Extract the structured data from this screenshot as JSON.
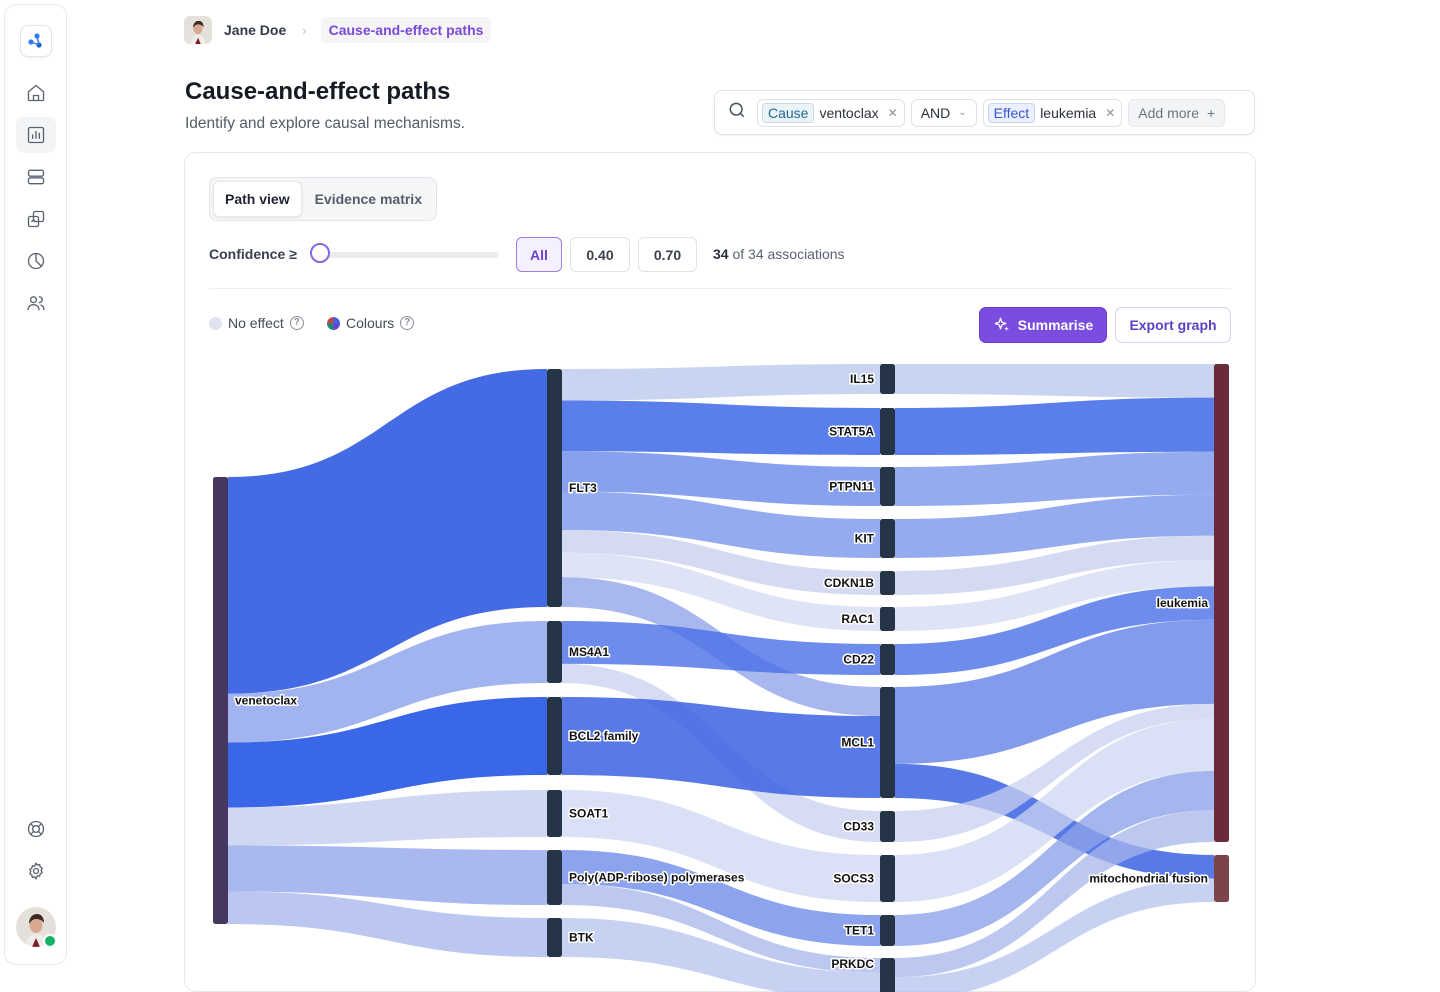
{
  "breadcrumb": {
    "user": "Jane Doe",
    "current": "Cause-and-effect paths"
  },
  "header": {
    "title": "Cause-and-effect paths",
    "subtitle": "Identify and explore causal mechanisms."
  },
  "search": {
    "cause_tag": "Cause",
    "cause_value": "ventoclax",
    "operator": "AND",
    "effect_tag": "Effect",
    "effect_value": "leukemia",
    "add_more": "Add more"
  },
  "tabs": {
    "path_view": "Path view",
    "evidence_matrix": "Evidence matrix"
  },
  "filter": {
    "confidence_label": "Confidence ≥",
    "confidence_value": 0,
    "thresholds": [
      "All",
      "0.40",
      "0.70"
    ],
    "count_shown": "34",
    "count_text": "of 34 associations"
  },
  "legend": {
    "no_effect": "No effect",
    "colours": "Colours"
  },
  "actions": {
    "summarise": "Summarise",
    "export": "Export graph"
  },
  "colors": {
    "accent": "#7a4ce0",
    "node": "#263447",
    "source_node": "#45375f",
    "target_leukemia": "#6b2a3a",
    "target_mito": "#7a4448"
  },
  "chart_data": {
    "type": "sankey",
    "nodes": [
      {
        "id": "venetoclax",
        "label": "venetoclax",
        "column": 0
      },
      {
        "id": "FLT3",
        "label": "FLT3",
        "column": 1
      },
      {
        "id": "MS4A1",
        "label": "MS4A1",
        "column": 1
      },
      {
        "id": "BCL2",
        "label": "BCL2 family",
        "column": 1
      },
      {
        "id": "SOAT1",
        "label": "SOAT1",
        "column": 1
      },
      {
        "id": "PARP",
        "label": "Poly(ADP-ribose) polymerases",
        "column": 1
      },
      {
        "id": "BTK",
        "label": "BTK",
        "column": 1
      },
      {
        "id": "IL15",
        "label": "IL15",
        "column": 2
      },
      {
        "id": "STAT5A",
        "label": "STAT5A",
        "column": 2
      },
      {
        "id": "PTPN11",
        "label": "PTPN11",
        "column": 2
      },
      {
        "id": "KIT",
        "label": "KIT",
        "column": 2
      },
      {
        "id": "CDKN1B",
        "label": "CDKN1B",
        "column": 2
      },
      {
        "id": "RAC1",
        "label": "RAC1",
        "column": 2
      },
      {
        "id": "CD22",
        "label": "CD22",
        "column": 2
      },
      {
        "id": "MCL1",
        "label": "MCL1",
        "column": 2
      },
      {
        "id": "CD33",
        "label": "CD33",
        "column": 2
      },
      {
        "id": "SOCS3",
        "label": "SOCS3",
        "column": 2
      },
      {
        "id": "TET1",
        "label": "TET1",
        "column": 2
      },
      {
        "id": "PRKDC",
        "label": "PRKDC",
        "column": 2
      },
      {
        "id": "leukemia",
        "label": "leukemia",
        "column": 3
      },
      {
        "id": "mito",
        "label": "mitochondrial fusion",
        "column": 3
      }
    ],
    "links": [
      {
        "source": "venetoclax",
        "target": "FLT3",
        "value": 160,
        "color": "#3b63e3",
        "opacity": 0.95
      },
      {
        "source": "venetoclax",
        "target": "MS4A1",
        "value": 36,
        "color": "#8ba1ec",
        "opacity": 0.8
      },
      {
        "source": "venetoclax",
        "target": "BCL2",
        "value": 48,
        "color": "#2f5fe6",
        "opacity": 0.95
      },
      {
        "source": "venetoclax",
        "target": "SOAT1",
        "value": 28,
        "color": "#c3cdf0",
        "opacity": 0.8
      },
      {
        "source": "venetoclax",
        "target": "PARP",
        "value": 34,
        "color": "#93a6ea",
        "opacity": 0.8
      },
      {
        "source": "venetoclax",
        "target": "BTK",
        "value": 24,
        "color": "#aab8ee",
        "opacity": 0.8
      },
      {
        "source": "FLT3",
        "target": "IL15",
        "value": 18,
        "color": "#b7c5ec",
        "opacity": 0.75
      },
      {
        "source": "FLT3",
        "target": "STAT5A",
        "value": 29,
        "color": "#3d67e6",
        "opacity": 0.85
      },
      {
        "source": "FLT3",
        "target": "PTPN11",
        "value": 23,
        "color": "#6a8aea",
        "opacity": 0.8
      },
      {
        "source": "FLT3",
        "target": "KIT",
        "value": 22,
        "color": "#7a96ec",
        "opacity": 0.8
      },
      {
        "source": "FLT3",
        "target": "CDKN1B",
        "value": 13,
        "color": "#c5cdee",
        "opacity": 0.75
      },
      {
        "source": "FLT3",
        "target": "RAC1",
        "value": 14,
        "color": "#d3d9f2",
        "opacity": 0.75
      },
      {
        "source": "FLT3",
        "target": "MCL1",
        "value": 17,
        "color": "#8b9fe8",
        "opacity": 0.75
      },
      {
        "source": "MS4A1",
        "target": "CD22",
        "value": 18,
        "color": "#4a6fe6",
        "opacity": 0.8
      },
      {
        "source": "MS4A1",
        "target": "CD33",
        "value": 8,
        "color": "#c8d0ef",
        "opacity": 0.75
      },
      {
        "source": "BCL2",
        "target": "MCL1",
        "value": 48,
        "color": "#3c62e2",
        "opacity": 0.85
      },
      {
        "source": "SOAT1",
        "target": "SOCS3",
        "value": 28,
        "color": "#cdd5f1",
        "opacity": 0.75
      },
      {
        "source": "PARP",
        "target": "TET1",
        "value": 21,
        "color": "#6f8cea",
        "opacity": 0.8
      },
      {
        "source": "PARP",
        "target": "PRKDC",
        "value": 13,
        "color": "#a7b6ec",
        "opacity": 0.75
      },
      {
        "source": "BTK",
        "target": "PRKDC",
        "value": 24,
        "color": "#b4c1ee",
        "opacity": 0.75
      },
      {
        "source": "IL15",
        "target": "leukemia",
        "value": 18,
        "color": "#b7c5ec",
        "opacity": 0.75
      },
      {
        "source": "STAT5A",
        "target": "leukemia",
        "value": 29,
        "color": "#3d67e6",
        "opacity": 0.85
      },
      {
        "source": "PTPN11",
        "target": "leukemia",
        "value": 23,
        "color": "#7a96ec",
        "opacity": 0.8
      },
      {
        "source": "KIT",
        "target": "leukemia",
        "value": 22,
        "color": "#7a96ec",
        "opacity": 0.8
      },
      {
        "source": "CDKN1B",
        "target": "leukemia",
        "value": 13,
        "color": "#c5cdee",
        "opacity": 0.75
      },
      {
        "source": "RAC1",
        "target": "leukemia",
        "value": 14,
        "color": "#d3d9f2",
        "opacity": 0.75
      },
      {
        "source": "CD22",
        "target": "leukemia",
        "value": 18,
        "color": "#4a6fe6",
        "opacity": 0.8
      },
      {
        "source": "MCL1",
        "target": "leukemia",
        "value": 45,
        "color": "#6c8ae9",
        "opacity": 0.85
      },
      {
        "source": "MCL1",
        "target": "mito",
        "value": 20,
        "color": "#3b63e3",
        "opacity": 0.85
      },
      {
        "source": "CD33",
        "target": "leukemia",
        "value": 8,
        "color": "#c8d0ef",
        "opacity": 0.75
      },
      {
        "source": "SOCS3",
        "target": "leukemia",
        "value": 28,
        "color": "#cdd5f1",
        "opacity": 0.75
      },
      {
        "source": "TET1",
        "target": "leukemia",
        "value": 21,
        "color": "#8ea3ea",
        "opacity": 0.8
      },
      {
        "source": "PRKDC",
        "target": "leukemia",
        "value": 17,
        "color": "#a7b6ec",
        "opacity": 0.75
      },
      {
        "source": "PRKDC",
        "target": "mito",
        "value": 20,
        "color": "#b4c1ee",
        "opacity": 0.75
      }
    ]
  }
}
